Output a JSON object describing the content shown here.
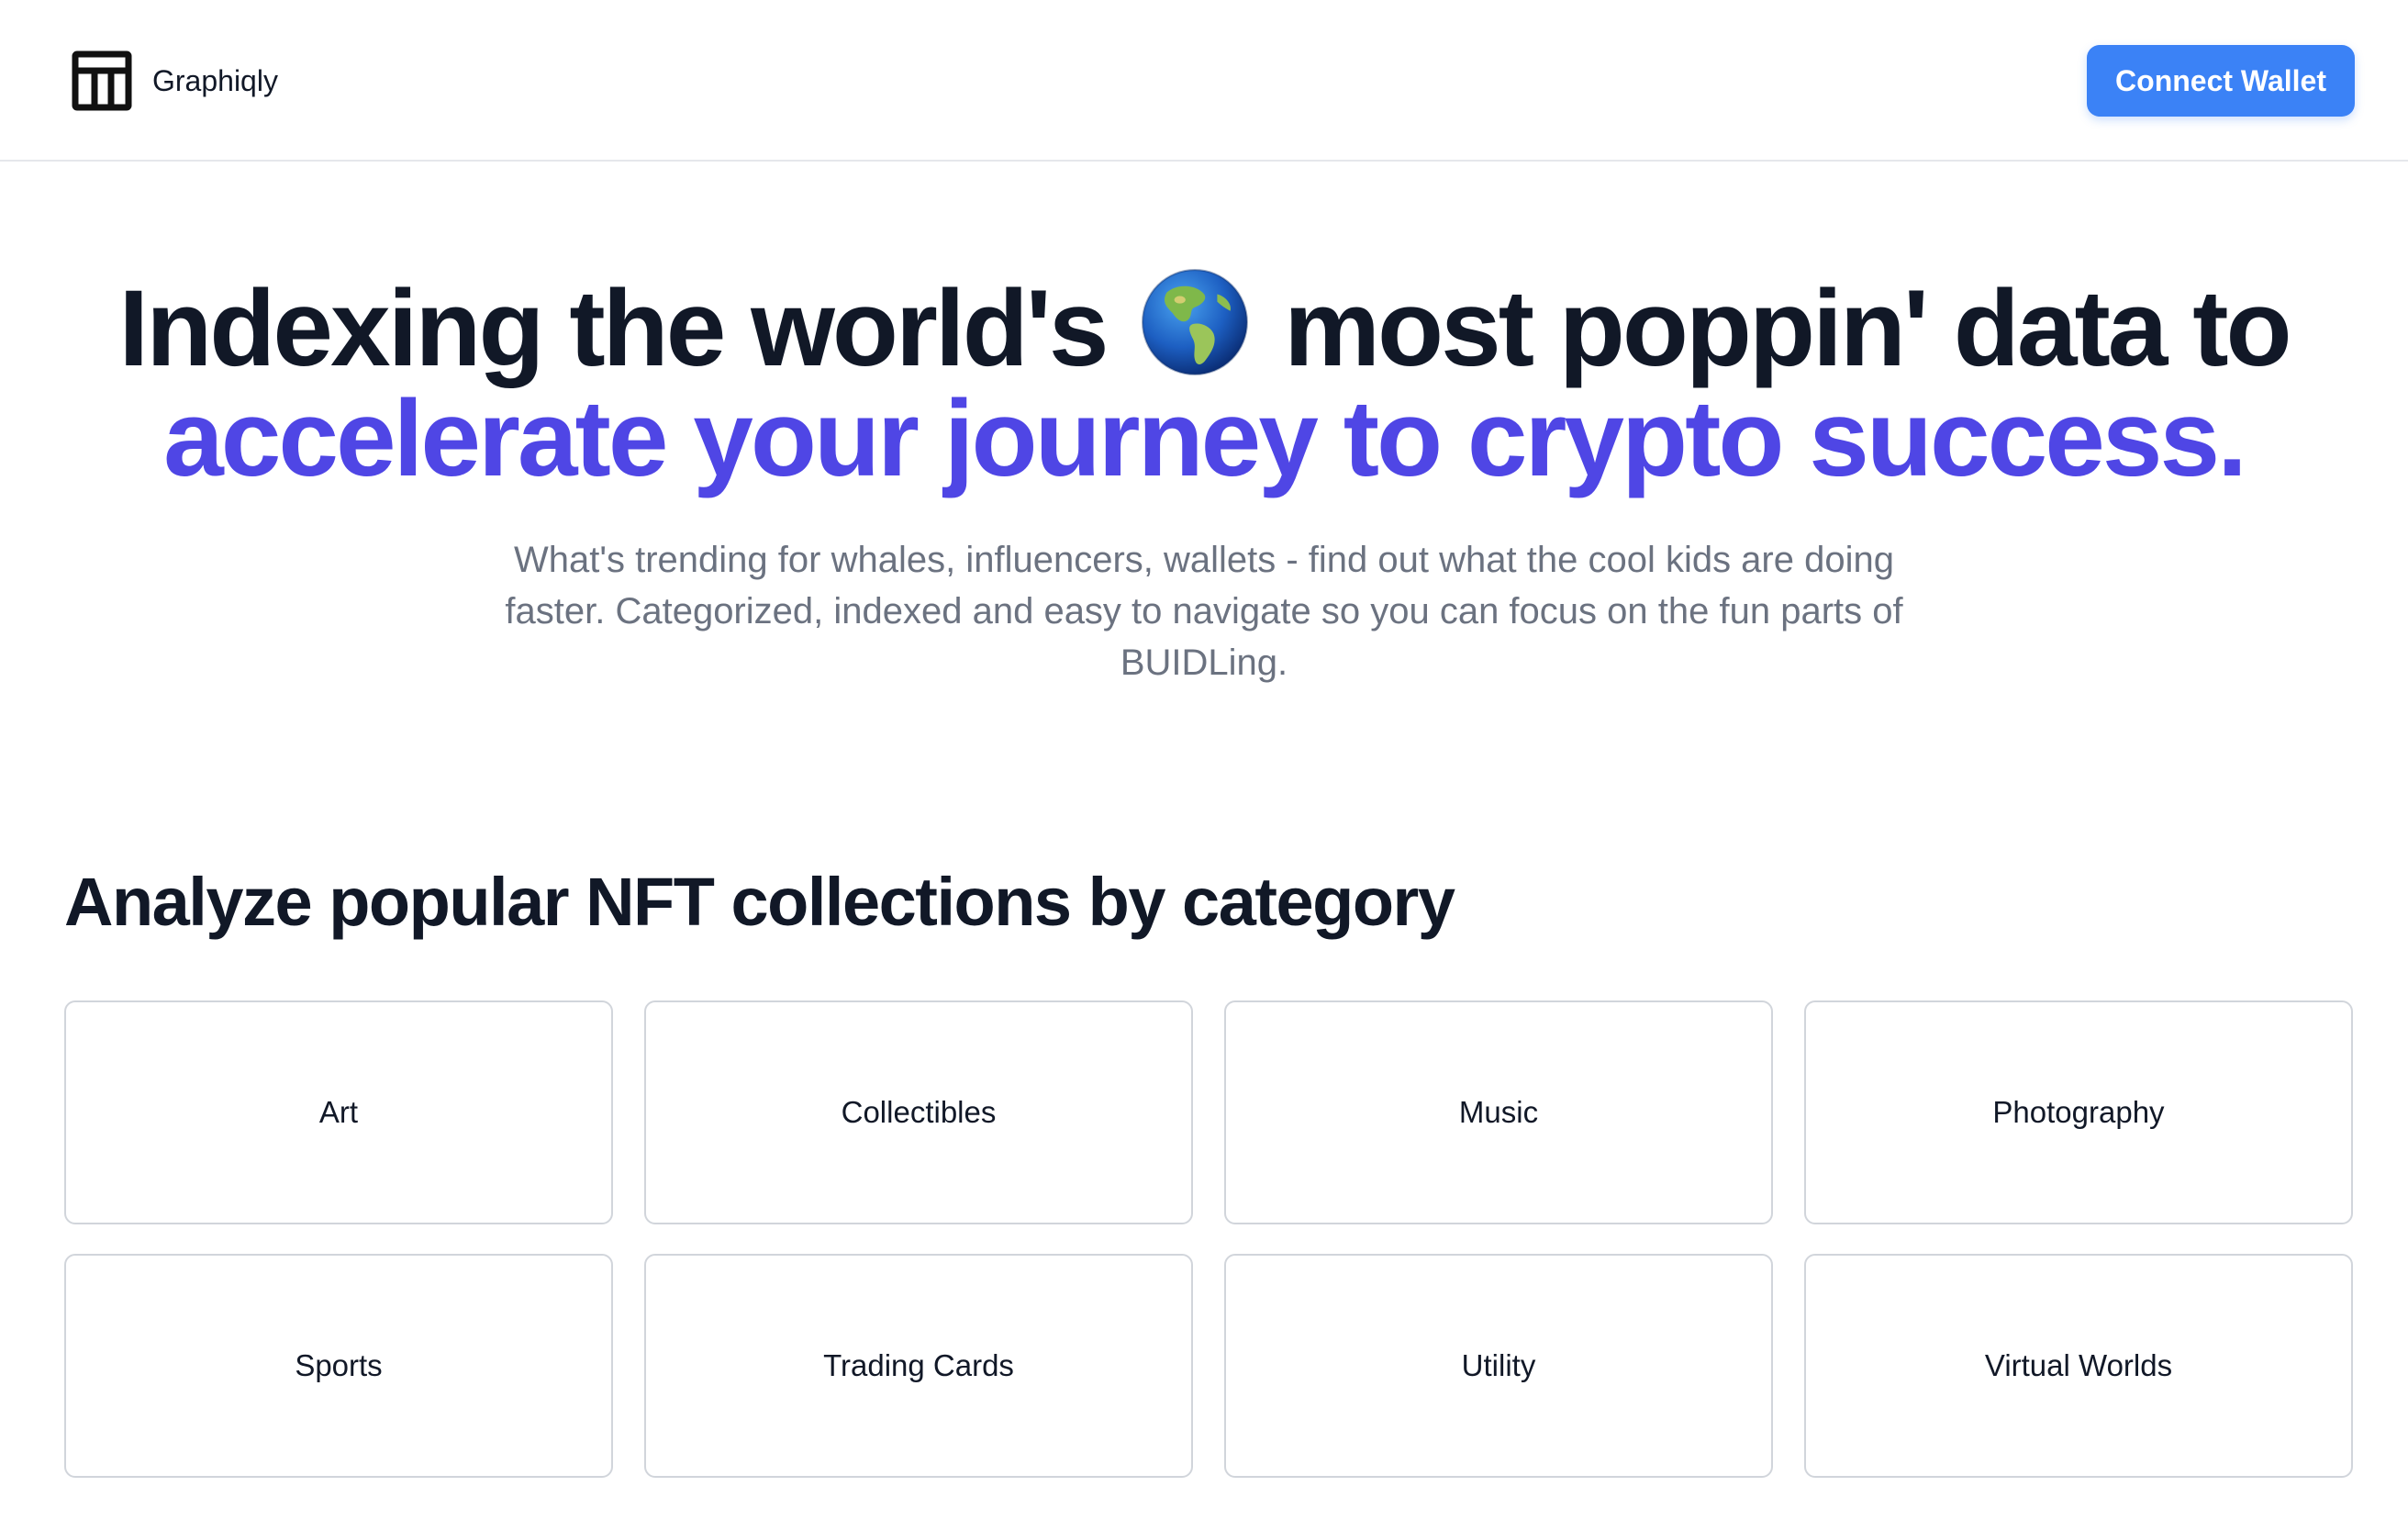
{
  "header": {
    "brand_name": "Graphiqly",
    "logo_icon": "table-layout-icon",
    "connect_button_label": "Connect Wallet"
  },
  "hero": {
    "title_part1": "Indexing the world's",
    "globe_icon": "globe-americas-emoji",
    "title_part2": "most poppin' data to",
    "title_accent": "accelerate your journey to crypto success.",
    "subtitle": "What's trending for whales, influencers, wallets - find out what the cool kids are doing faster. Categorized, indexed and easy to navigate so you can focus on the fun parts of BUIDLing."
  },
  "categories_section": {
    "title": "Analyze popular NFT collections by category",
    "items": [
      {
        "label": "Art"
      },
      {
        "label": "Collectibles"
      },
      {
        "label": "Music"
      },
      {
        "label": "Photography"
      },
      {
        "label": "Sports"
      },
      {
        "label": "Trading Cards"
      },
      {
        "label": "Utility"
      },
      {
        "label": "Virtual Worlds"
      }
    ]
  },
  "colors": {
    "accent": "#4f46e5",
    "button": "#3b82f6",
    "text": "#111827",
    "muted": "#6b7280",
    "border": "#d1d5db"
  }
}
